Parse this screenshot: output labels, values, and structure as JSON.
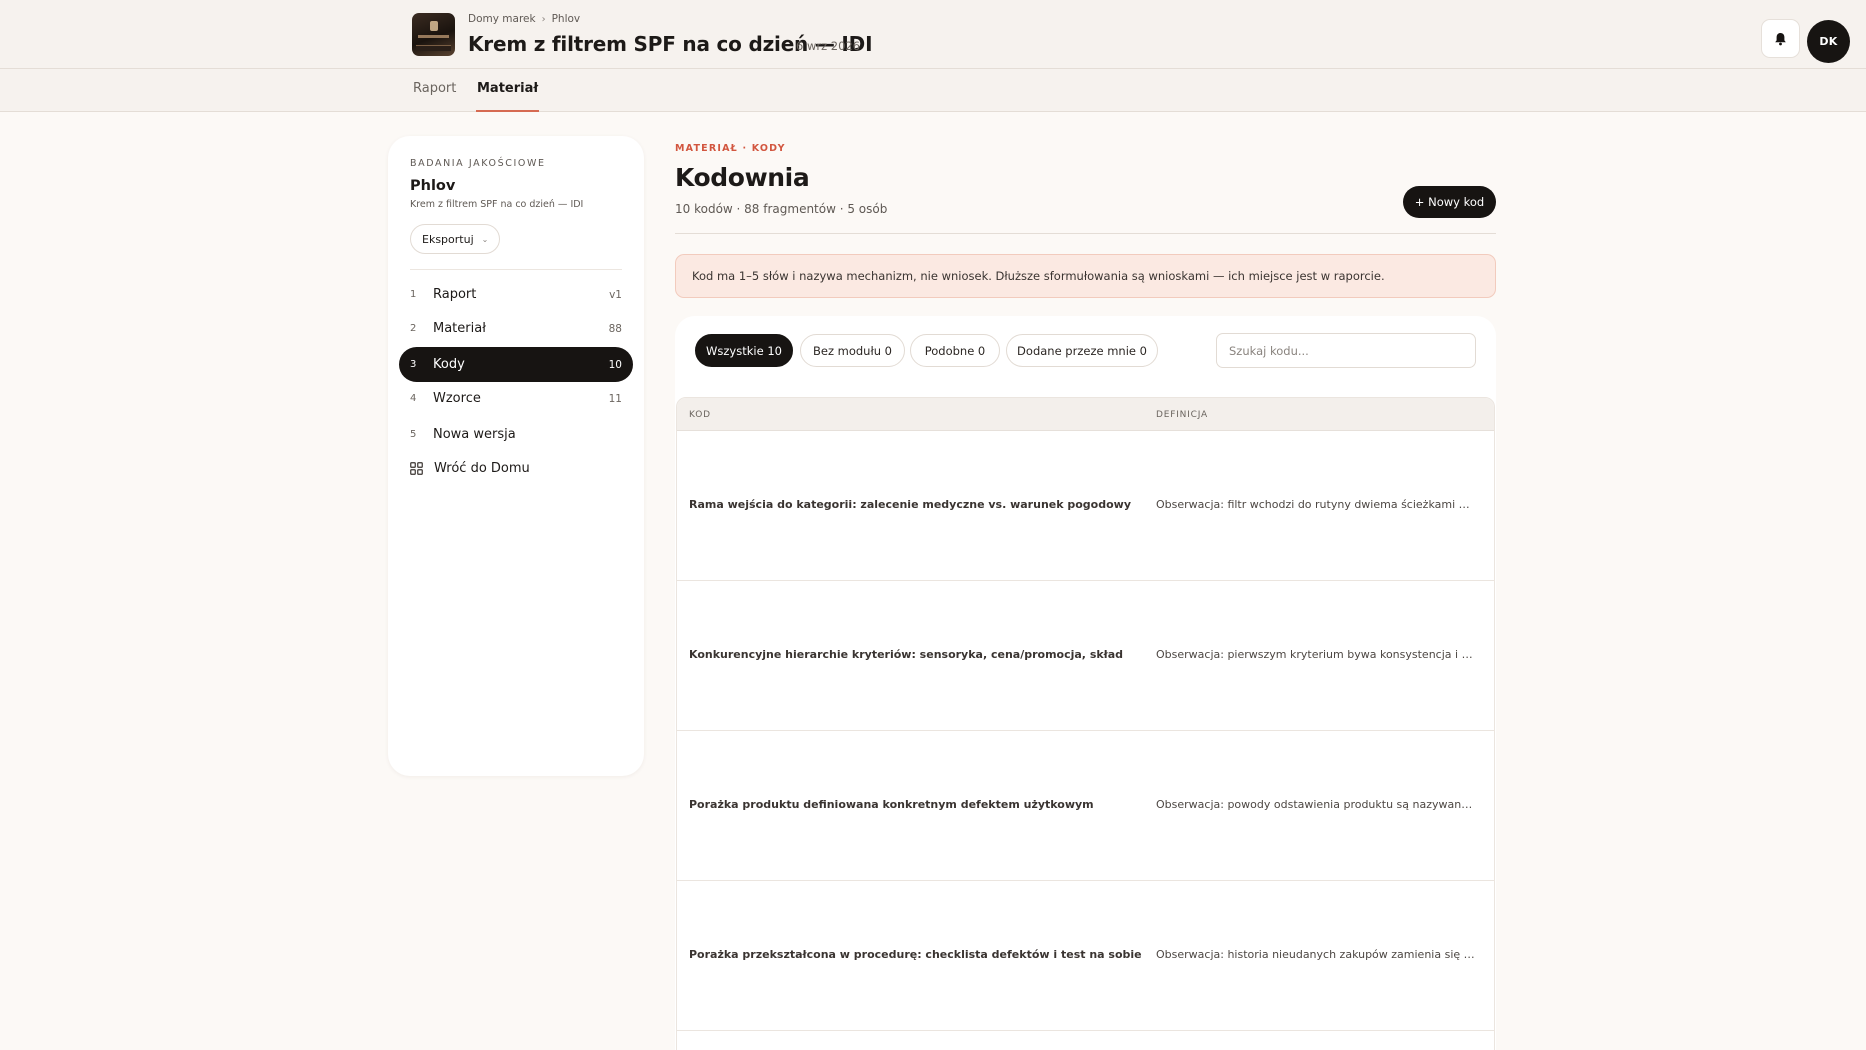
{
  "header": {
    "breadcrumb": [
      "Domy marek",
      "Phlov"
    ],
    "title": "Krem z filtrem SPF na co dzień — IDI",
    "date": "6 wrz 2026",
    "avatar_initials": "DK",
    "notification_icon": "bell-icon",
    "brand_thumb": "brand-thumbnail-image"
  },
  "tabs": [
    {
      "label": "Raport",
      "active": false
    },
    {
      "label": "Materiał",
      "active": true
    }
  ],
  "sidebar": {
    "overline": "BADANIA JAKOŚCIOWE",
    "name": "Phlov",
    "subtitle": "Krem z filtrem SPF na co dzień — IDI",
    "export_label": "Eksportuj",
    "items": [
      {
        "num": "1",
        "label": "Raport",
        "count": "v1",
        "active": false
      },
      {
        "num": "2",
        "label": "Materiał",
        "count": "88",
        "active": false
      },
      {
        "num": "3",
        "label": "Kody",
        "count": "10",
        "active": true
      },
      {
        "num": "4",
        "label": "Wzorce",
        "count": "11",
        "active": false
      },
      {
        "num": "5",
        "label": "Nowa wersja",
        "count": "",
        "active": false
      }
    ],
    "back_label": "Wróć do Domu",
    "back_icon": "grid-icon"
  },
  "main": {
    "overline": "MATERIAŁ · KODY",
    "title": "Kodownia",
    "meta": "10 kodów · 88 fragmentów · 5 osób",
    "new_button": "+ Nowy kod",
    "notice": "Kod ma 1–5 słów i nazywa mechanizm, nie wniosek. Dłuższe sformułowania są wnioskami — ich miejsce jest w raporcie.",
    "filters": [
      {
        "label": "Wszystkie 10",
        "active": true
      },
      {
        "label": "Bez modułu 0",
        "active": false
      },
      {
        "label": "Podobne 0",
        "active": false
      },
      {
        "label": "Dodane przeze mnie 0",
        "active": false
      }
    ],
    "search_placeholder": "Szukaj kodu...",
    "table": {
      "columns": [
        "KOD",
        "DEFINICJA"
      ],
      "rows": [
        {
          "code": "Rama wejścia do kategorii: zalecenie medyczne vs. warunek pogodowy",
          "definition": "Obserwacja: filtr wchodzi do rutyny dwiema ścieżkami — po ..."
        },
        {
          "code": "Konkurencyjne hierarchie kryteriów: sensoryka, cena/promocja, skład",
          "definition": "Obserwacja: pierwszym kryterium bywa konsystencja i finisz ..."
        },
        {
          "code": "Porażka produktu definiowana konkretnym defektem użytkowym",
          "definition": "Obserwacja: powody odstawienia produktu są nazywane op..."
        },
        {
          "code": "Porażka przekształcona w procedurę: checklista defektów i test na sobie",
          "definition": "Obserwacja: historia nieudanych zakupów zamienia się w kol..."
        }
      ]
    }
  },
  "colors": {
    "accent": "#d2563f",
    "dark": "#171412",
    "background": "#fcf9f6",
    "notice_bg": "#fbe9e2"
  }
}
